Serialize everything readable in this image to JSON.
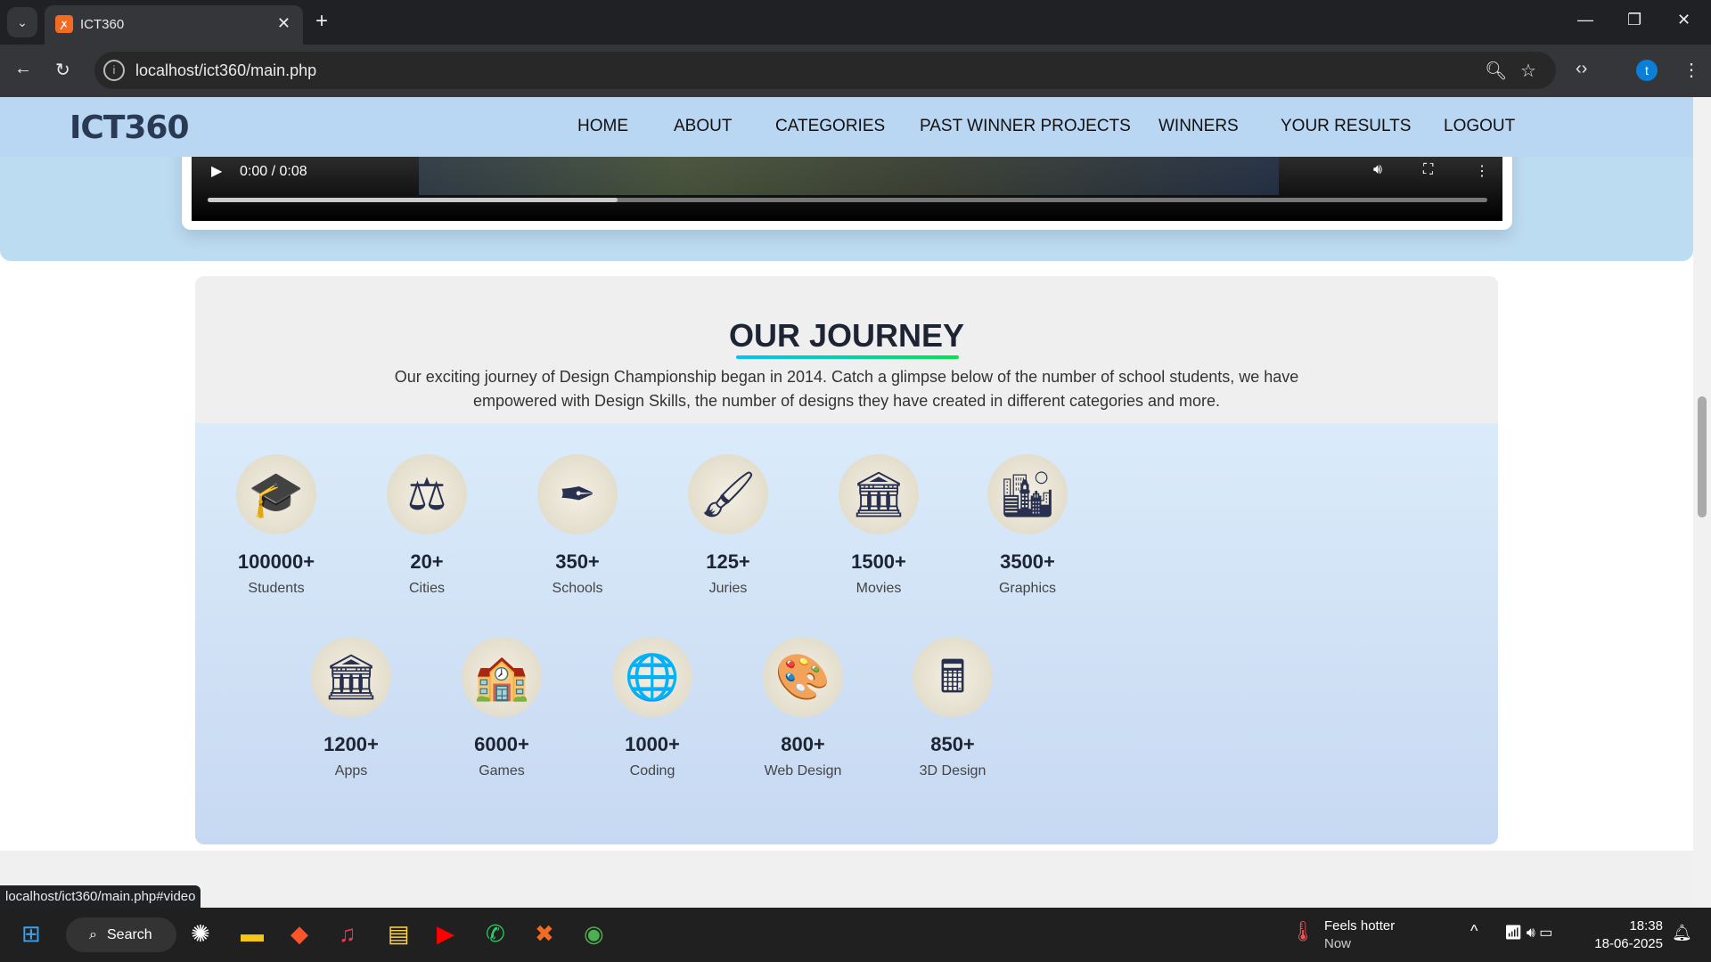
{
  "browser": {
    "tab_title": "ICT360",
    "favicon": "xampp-icon",
    "url": "localhost/ict360/main.php",
    "profile_initial": "t"
  },
  "nav": {
    "logo": "ICT360",
    "items": [
      "HOME",
      "ABOUT",
      "CATEGORIES",
      "PAST WINNER PROJECTS",
      "WINNERS",
      "YOUR RESULTS",
      "LOGOUT"
    ]
  },
  "video": {
    "time": "0:00 / 0:08",
    "progress_percent": 32
  },
  "journey": {
    "title": "OUR JOURNEY",
    "description": "Our exciting journey of Design Championship began in 2014. Catch a glimpse below of the number of school students, we have empowered with Design Skills, the number of designs they have created in different categories and more.",
    "stats": [
      {
        "value": "100000+",
        "label": "Students",
        "icon": "graduation-cap-icon",
        "glyph": "🎓"
      },
      {
        "value": "20+",
        "label": "Cities",
        "icon": "scales-icon",
        "glyph": "⚖"
      },
      {
        "value": "350+",
        "label": "Schools",
        "icon": "pen-tools-icon",
        "glyph": "✒"
      },
      {
        "value": "125+",
        "label": "Juries",
        "icon": "paintbrush-icon",
        "glyph": "🖌"
      },
      {
        "value": "1500+",
        "label": "Movies",
        "icon": "building-icon",
        "glyph": "🏛"
      },
      {
        "value": "3500+",
        "label": "Graphics",
        "icon": "skyscraper-icon",
        "glyph": "🏙"
      },
      {
        "value": "1200+",
        "label": "Apps",
        "icon": "capitol-icon",
        "glyph": "🏛"
      },
      {
        "value": "6000+",
        "label": "Games",
        "icon": "school-icon",
        "glyph": "🏫"
      },
      {
        "value": "1000+",
        "label": "Coding",
        "icon": "globe-icon",
        "glyph": "🌐"
      },
      {
        "value": "800+",
        "label": "Web Design",
        "icon": "palette-icon",
        "glyph": "🎨"
      },
      {
        "value": "850+",
        "label": "3D Design",
        "icon": "calculator-icon",
        "glyph": "🖩"
      }
    ]
  },
  "status_bar": {
    "link": "localhost/ict360/main.php#video"
  },
  "taskbar": {
    "search": "Search",
    "weather_title": "Feels hotter",
    "weather_sub": "Now",
    "time": "18:38",
    "date": "18-06-2025"
  }
}
